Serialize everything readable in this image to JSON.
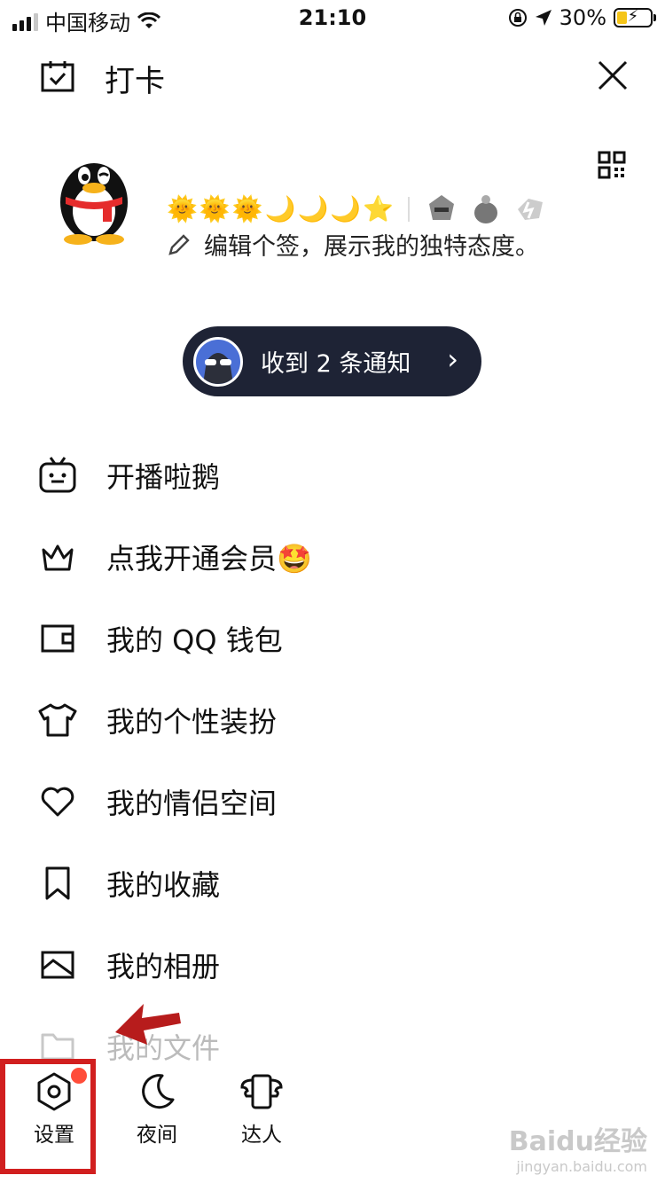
{
  "status_bar": {
    "carrier": "中国移动",
    "time": "21:10",
    "battery_percent": "30%",
    "battery_level": 0.3,
    "battery_color": "#f5c518"
  },
  "header": {
    "title": "打卡",
    "title_icon": "calendar-check-icon",
    "close_icon": "close-icon",
    "qr_icon": "qr-code-icon"
  },
  "profile": {
    "avatar": "qq-penguin-avatar",
    "level_icons": [
      "sun",
      "sun",
      "sun",
      "moon",
      "moon",
      "moon",
      "star"
    ],
    "badges": [
      "badge-1",
      "badge-2",
      "badge-3"
    ],
    "signature": "编辑个签，展示我的独特态度。"
  },
  "notification": {
    "text": "收到 2 条通知"
  },
  "menu": {
    "items": [
      {
        "label": "开播啦鹅",
        "icon": "tv-icon"
      },
      {
        "label": "点我开通会员🤩",
        "icon": "crown-icon"
      },
      {
        "label": "我的 QQ 钱包",
        "icon": "wallet-icon"
      },
      {
        "label": "我的个性装扮",
        "icon": "tshirt-icon"
      },
      {
        "label": "我的情侣空间",
        "icon": "heart-icon"
      },
      {
        "label": "我的收藏",
        "icon": "bookmark-icon"
      },
      {
        "label": "我的相册",
        "icon": "image-icon"
      },
      {
        "label": "我的文件",
        "icon": "folder-icon"
      }
    ]
  },
  "tabs": [
    {
      "label": "设置",
      "icon": "settings-hexagon-icon",
      "has_dot": true
    },
    {
      "label": "夜间",
      "icon": "moon-icon"
    },
    {
      "label": "达人",
      "icon": "wing-phone-icon"
    }
  ],
  "colors": {
    "notification_bg": "#1e2335",
    "highlight": "#d11f1f",
    "red_dot": "#ff4d3a"
  },
  "watermark": {
    "brand": "Baidu经验",
    "url": "jingyan.baidu.com"
  }
}
